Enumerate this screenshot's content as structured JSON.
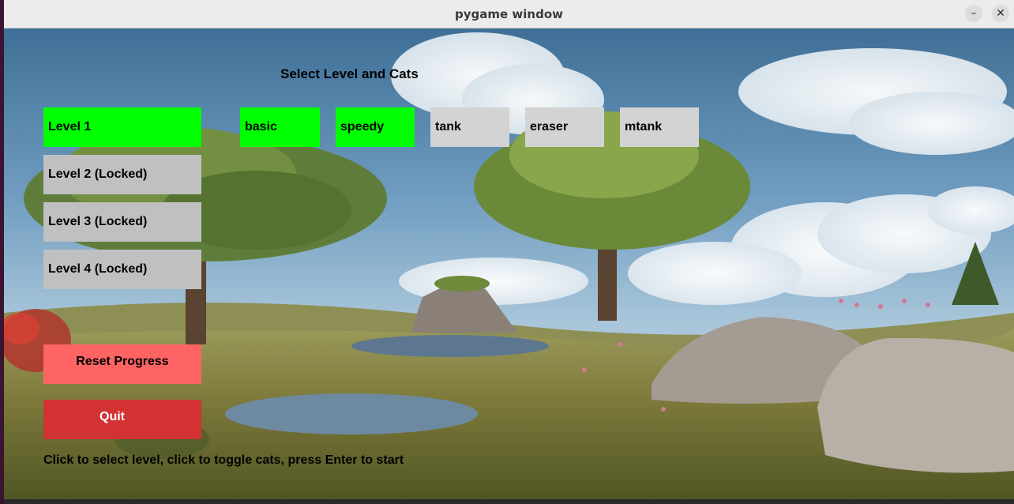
{
  "window": {
    "title": "pygame window",
    "minimize_glyph": "–",
    "close_glyph": "✕"
  },
  "menu": {
    "heading": "Select Level and Cats",
    "levels": [
      {
        "label": "Level 1",
        "selected": true
      },
      {
        "label": "Level 2 (Locked)",
        "selected": false
      },
      {
        "label": "Level 3 (Locked)",
        "selected": false
      },
      {
        "label": "Level 4 (Locked)",
        "selected": false
      }
    ],
    "cats": [
      {
        "label": "basic",
        "selected": true
      },
      {
        "label": "speedy",
        "selected": true
      },
      {
        "label": "tank",
        "selected": false
      },
      {
        "label": "eraser",
        "selected": false
      },
      {
        "label": "mtank",
        "selected": false
      }
    ],
    "reset_label": "Reset Progress",
    "quit_label": "Quit",
    "hint": "Click to select level, click to toggle cats, press Enter to start"
  },
  "colors": {
    "selected": "#00ff00",
    "locked": "#c0c0c0",
    "unselected_cat": "#d3d3d3",
    "reset": "#ff6464",
    "quit": "#d23232"
  }
}
